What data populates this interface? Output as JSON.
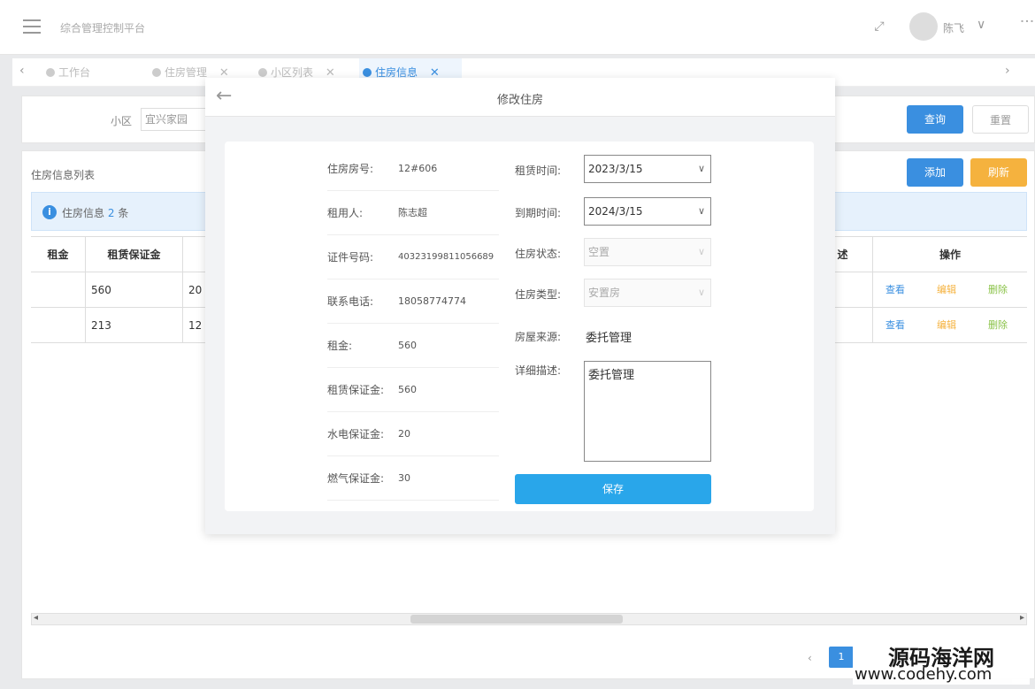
{
  "header": {
    "app_title": "综合管理控制平台",
    "user_name": "陈飞",
    "fullscreen_glyph": "⤢",
    "chevron_glyph": "∨",
    "more_glyph": "⋮"
  },
  "tabs": [
    {
      "label": "工作台",
      "active": false
    },
    {
      "label": "住房管理",
      "active": false
    },
    {
      "label": "小区列表",
      "active": false
    },
    {
      "label": "住房信息",
      "active": true
    }
  ],
  "tab_arrows": {
    "left": "‹",
    "right": "›"
  },
  "search": {
    "label": "小区",
    "value": "宜兴家园",
    "query_button": "查询",
    "reset_button": "重置"
  },
  "list": {
    "title": "住房信息列表",
    "add_button": "添加",
    "refresh_button": "刷新",
    "info_prefix": "住房信息",
    "info_count": "2",
    "info_suffix": "条",
    "columns": {
      "col_a": "租金",
      "col_b": "租赁保证金",
      "col_c": "",
      "col_desc": "述",
      "col_ops": "操作"
    },
    "rows": [
      {
        "col_b": "560",
        "col_c": "20"
      },
      {
        "col_b": "213",
        "col_c": "12"
      }
    ],
    "op_view": "查看",
    "op_edit": "编辑",
    "op_delete": "删除",
    "page_number": "1"
  },
  "modal": {
    "title": "修改住房",
    "back_glyph": "←",
    "left_fields": [
      {
        "label": "住房房号:",
        "value": "12#606"
      },
      {
        "label": "租用人:",
        "value": "陈志超"
      },
      {
        "label": "证件号码:",
        "value": "40323199811056689"
      },
      {
        "label": "联系电话:",
        "value": "18058774774"
      },
      {
        "label": "租金:",
        "value": "560"
      },
      {
        "label": "租赁保证金:",
        "value": "560"
      },
      {
        "label": "水电保证金:",
        "value": "20"
      },
      {
        "label": "燃气保证金:",
        "value": "30"
      }
    ],
    "right_fields": {
      "rent_time_label": "租赁时间:",
      "rent_time_value": "2023/3/15",
      "expire_time_label": "到期时间:",
      "expire_time_value": "2024/3/15",
      "status_label": "住房状态:",
      "status_value": "空置",
      "type_label": "住房类型:",
      "type_value": "安置房",
      "source_label": "房屋来源:",
      "source_value": "委托管理",
      "desc_label": "详细描述:",
      "desc_value": "委托管理"
    },
    "save_button": "保存"
  },
  "watermark": {
    "line1": "源码海洋网",
    "line2": "www.codehy.com"
  },
  "colors": {
    "primary": "#3a8fe0",
    "warning": "#f5b23e",
    "save": "#29a6ea",
    "delete": "#8bc34a"
  }
}
